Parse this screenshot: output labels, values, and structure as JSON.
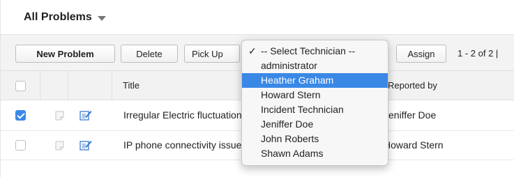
{
  "header": {
    "title": "All Problems"
  },
  "toolbar": {
    "new_label": "New Problem",
    "delete_label": "Delete",
    "pickup_label": "Pick Up",
    "assign_label": "Assign",
    "pagination": "1 - 2 of 2 |"
  },
  "table": {
    "columns": {
      "title": "Title",
      "reported_by": "Reported by"
    },
    "rows": [
      {
        "checked": true,
        "title": "Irregular Electric fluctuations",
        "reported_by": "Jeniffer Doe"
      },
      {
        "checked": false,
        "title": "IP phone connectivity issues",
        "reported_by": "Howard Stern"
      }
    ]
  },
  "technician_dropdown": {
    "selected_marker": "✓",
    "options": [
      "-- Select Technician --",
      "administrator",
      "Heather Graham",
      "Howard Stern",
      "Incident Technician",
      "Jeniffer Doe",
      "John Roberts",
      "Shawn Adams"
    ],
    "selected_index": 0,
    "highlighted_index": 2
  },
  "colors": {
    "accent": "#3a88e6",
    "toolbar_bg": "#f3f3f3",
    "header_row_bg": "#f2f2f2"
  },
  "icons": {
    "header_caret": "chevron-down-icon",
    "note": "note-icon",
    "edit": "edit-icon"
  }
}
